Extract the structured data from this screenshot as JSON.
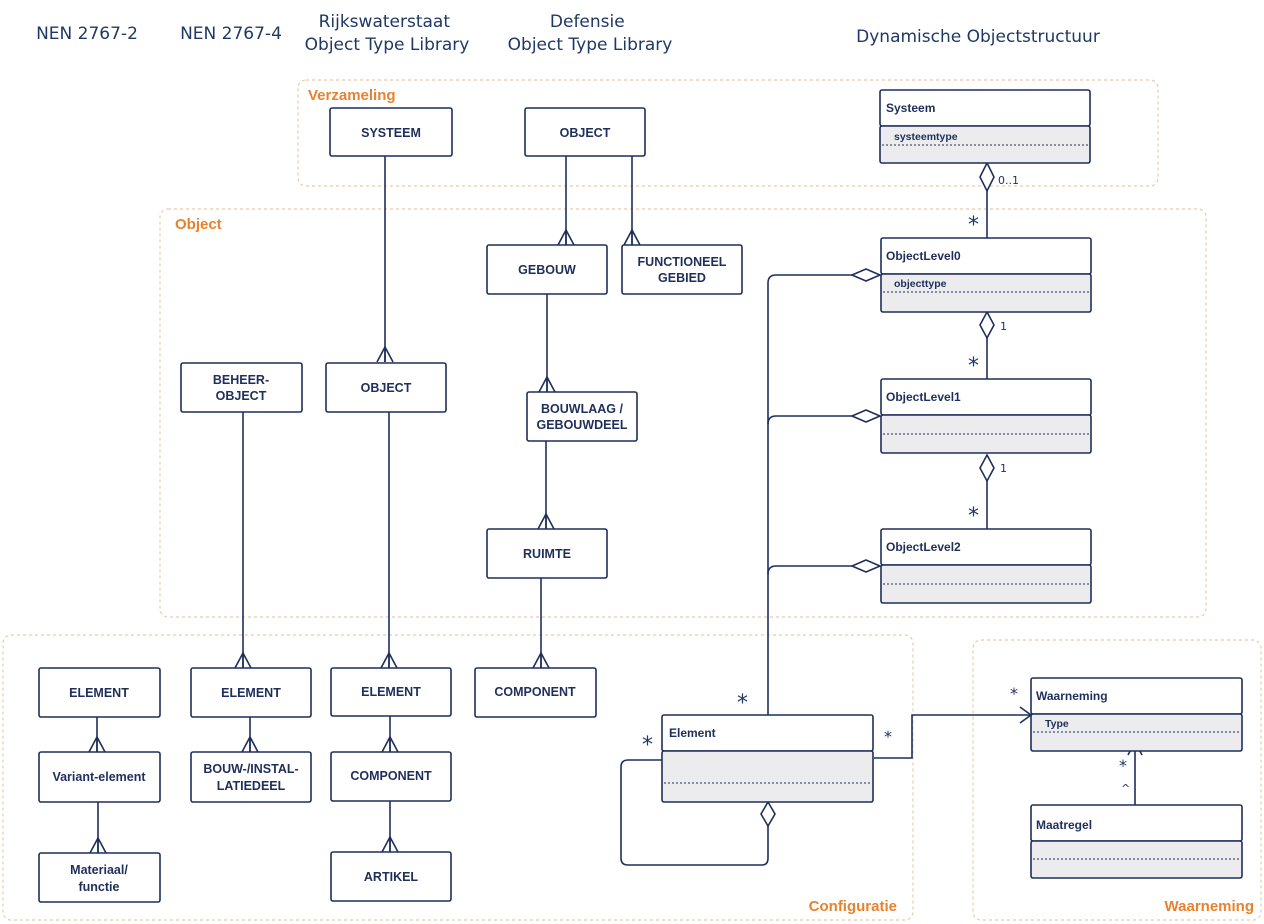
{
  "headers": [
    {
      "lines": [
        "NEN 2767-2"
      ]
    },
    {
      "lines": [
        "NEN 2767-4"
      ]
    },
    {
      "lines": [
        "Rijkswaterstaat",
        "Object Type Library"
      ]
    },
    {
      "lines": [
        "Defensie",
        "Object Type Library"
      ]
    },
    {
      "lines": [
        "Dynamische Objectstructuur"
      ]
    }
  ],
  "groups": {
    "verzameling": "Verzameling",
    "object": "Object",
    "configuratie": "Configuratie",
    "waarneming": "Waarneming"
  },
  "boxes": {
    "rws_systeem": [
      "SYSTEEM"
    ],
    "def_object": [
      "OBJECT"
    ],
    "def_gebouw": [
      "GEBOUW"
    ],
    "def_functioneel": [
      "FUNCTIONEEL",
      "GEBIED"
    ],
    "nen4_beheerobject": [
      "BEHEER-",
      "OBJECT"
    ],
    "rws_object": [
      "OBJECT"
    ],
    "def_bouwlaag": [
      "BOUWLAAG /",
      "GEBOUWDEEL"
    ],
    "def_ruimte": [
      "RUIMTE"
    ],
    "nen2_element": [
      "ELEMENT"
    ],
    "nen2_variant": [
      "Variant-element"
    ],
    "nen2_materiaal": [
      "Materiaal/",
      "functie"
    ],
    "nen4_element": [
      "ELEMENT"
    ],
    "nen4_bouwdeel": [
      "BOUW-/INSTAL-",
      "LATIEDEEL"
    ],
    "rws_element": [
      "ELEMENT"
    ],
    "rws_component": [
      "COMPONENT"
    ],
    "rws_artikel": [
      "ARTIKEL"
    ],
    "def_component": [
      "COMPONENT"
    ]
  },
  "classes": {
    "systeem": {
      "title": "Systeem",
      "attr": "systeemtype"
    },
    "level0": {
      "title": "ObjectLevel0",
      "attr": "objecttype"
    },
    "level1": {
      "title": "ObjectLevel1",
      "attr": ""
    },
    "level2": {
      "title": "ObjectLevel2",
      "attr": ""
    },
    "element": {
      "title": "Element",
      "attr": ""
    },
    "waarneming": {
      "title": "Waarneming",
      "attr": "Type"
    },
    "maatregel": {
      "title": "Maatregel",
      "attr": ""
    }
  },
  "multiplicities": {
    "systeem_level0": "0..1",
    "level0_level1": "1",
    "level1_level2": "1",
    "many": "*",
    "caret": "^"
  }
}
